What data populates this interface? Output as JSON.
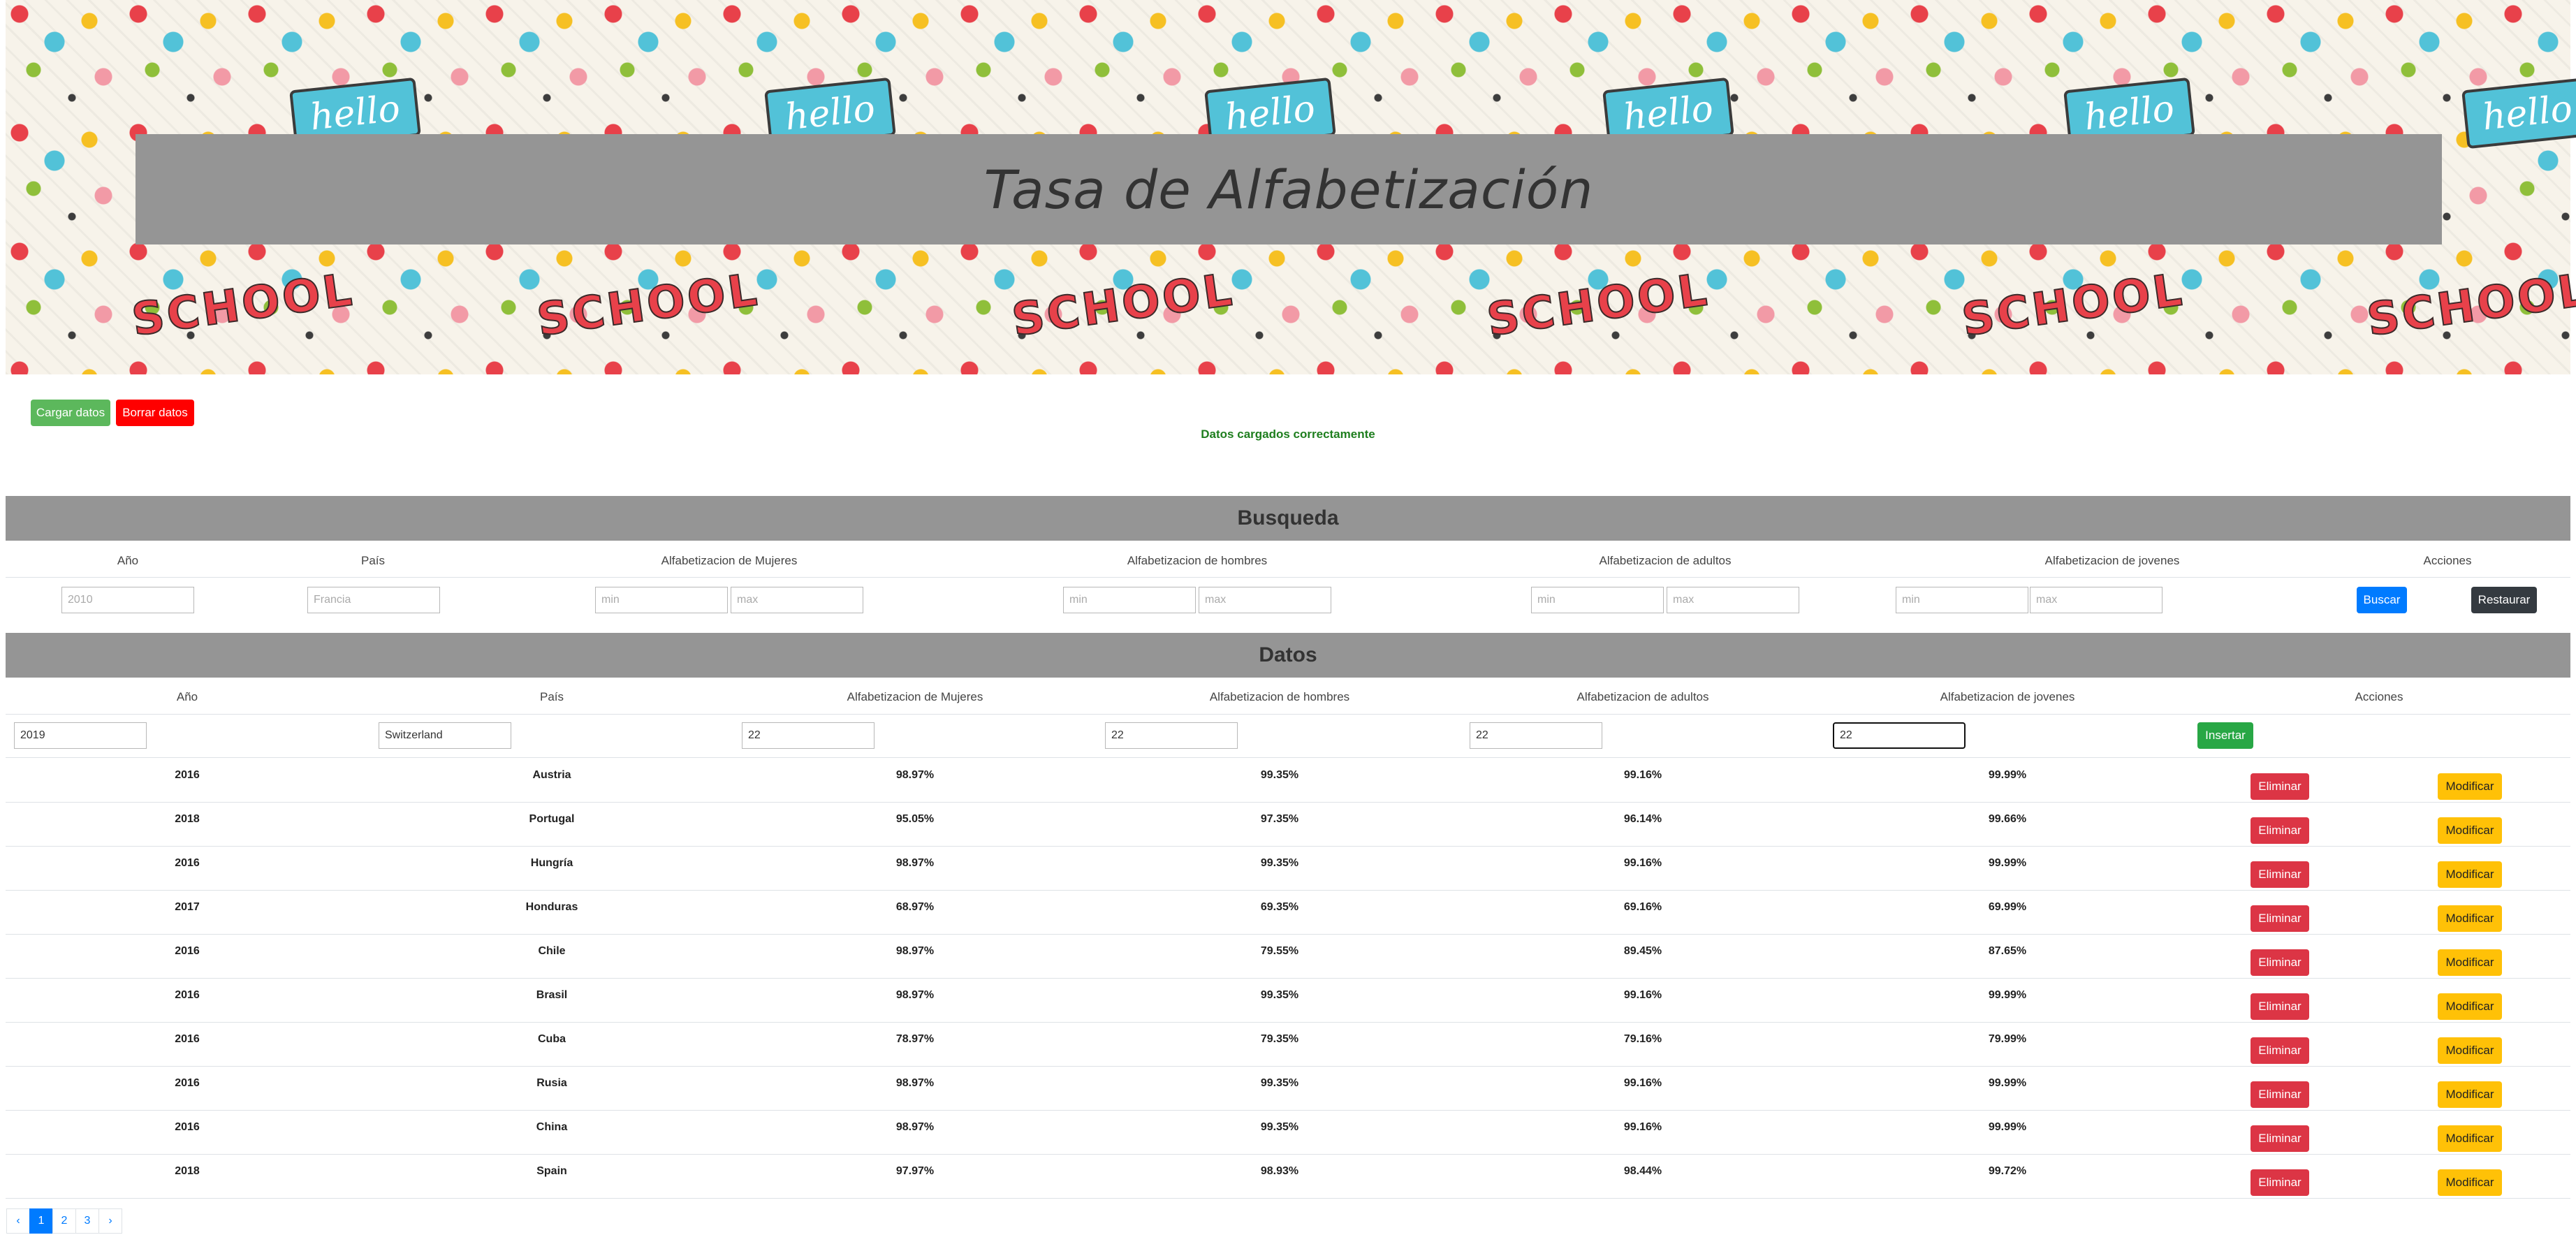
{
  "banner": {
    "title": "Tasa de Alfabetización",
    "decor_words": [
      "SCHOOL",
      "hello"
    ]
  },
  "actions": {
    "load_label": "Cargar datos",
    "clear_label": "Borrar datos",
    "status": "Datos cargados correctamente"
  },
  "search": {
    "title": "Busqueda",
    "headers": [
      "Año",
      "País",
      "Alfabetizacion de Mujeres",
      "Alfabetizacion de hombres",
      "Alfabetizacion de adultos",
      "Alfabetizacion de jovenes",
      "Acciones"
    ],
    "year_placeholder": "2010",
    "country_placeholder": "Francia",
    "min_placeholder": "min",
    "max_placeholder": "max",
    "search_label": "Buscar",
    "reset_label": "Restaurar"
  },
  "data": {
    "title": "Datos",
    "headers": [
      "Año",
      "País",
      "Alfabetizacion de Mujeres",
      "Alfabetizacion de hombres",
      "Alfabetizacion de adultos",
      "Alfabetizacion de jovenes",
      "Acciones"
    ],
    "new_row": {
      "year": "2019",
      "country": "Switzerland",
      "women": "22",
      "men": "22",
      "adults": "22",
      "youth": "22"
    },
    "insert_label": "Insertar",
    "delete_label": "Eliminar",
    "modify_label": "Modificar",
    "rows": [
      {
        "year": "2016",
        "country": "Austria",
        "women": "98.97%",
        "men": "99.35%",
        "adults": "99.16%",
        "youth": "99.99%"
      },
      {
        "year": "2018",
        "country": "Portugal",
        "women": "95.05%",
        "men": "97.35%",
        "adults": "96.14%",
        "youth": "99.66%"
      },
      {
        "year": "2016",
        "country": "Hungría",
        "women": "98.97%",
        "men": "99.35%",
        "adults": "99.16%",
        "youth": "99.99%"
      },
      {
        "year": "2017",
        "country": "Honduras",
        "women": "68.97%",
        "men": "69.35%",
        "adults": "69.16%",
        "youth": "69.99%"
      },
      {
        "year": "2016",
        "country": "Chile",
        "women": "98.97%",
        "men": "79.55%",
        "adults": "89.45%",
        "youth": "87.65%"
      },
      {
        "year": "2016",
        "country": "Brasil",
        "women": "98.97%",
        "men": "99.35%",
        "adults": "99.16%",
        "youth": "99.99%"
      },
      {
        "year": "2016",
        "country": "Cuba",
        "women": "78.97%",
        "men": "79.35%",
        "adults": "79.16%",
        "youth": "79.99%"
      },
      {
        "year": "2016",
        "country": "Rusia",
        "women": "98.97%",
        "men": "99.35%",
        "adults": "99.16%",
        "youth": "99.99%"
      },
      {
        "year": "2016",
        "country": "China",
        "women": "98.97%",
        "men": "99.35%",
        "adults": "99.16%",
        "youth": "99.99%"
      },
      {
        "year": "2018",
        "country": "Spain",
        "women": "97.97%",
        "men": "98.93%",
        "adults": "98.44%",
        "youth": "99.72%"
      }
    ]
  },
  "pagination": {
    "prev": "‹",
    "pages": [
      "1",
      "2",
      "3"
    ],
    "next": "›",
    "active": "1"
  },
  "colors": {
    "load": "#5cb85c",
    "clear": "#ff0000",
    "buscar": "#007bff",
    "restaurar": "#343a40",
    "insertar": "#28a745",
    "eliminar": "#dc3545",
    "modificar": "#ffc107",
    "section_bar": "#959595"
  }
}
